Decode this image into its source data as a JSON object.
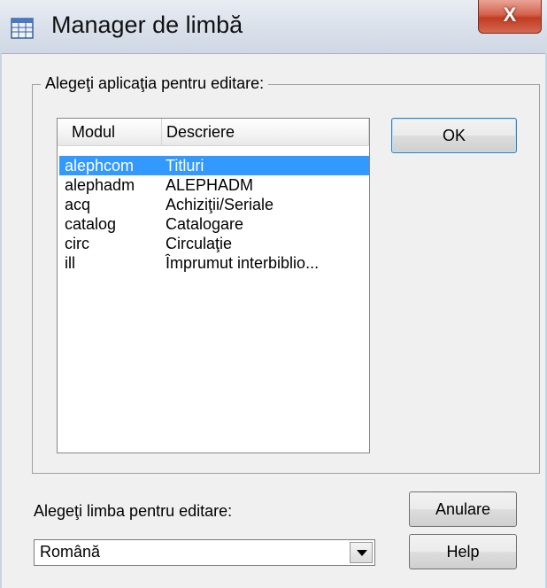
{
  "window": {
    "title": "Manager de limbă",
    "close_glyph": "X",
    "icon": "table-icon"
  },
  "module_group": {
    "legend": "Alegeţi aplicaţia pentru editare:",
    "columns": [
      "Modul",
      "Descriere"
    ],
    "rows": [
      {
        "modul": "alephcom",
        "descriere": "Titluri",
        "selected": true
      },
      {
        "modul": "alephadm",
        "descriere": "ALEPHADM",
        "selected": false
      },
      {
        "modul": "acq",
        "descriere": "Achiziţii/Seriale",
        "selected": false
      },
      {
        "modul": "catalog",
        "descriere": "Catalogare",
        "selected": false
      },
      {
        "modul": "circ",
        "descriere": "Circulaţie",
        "selected": false
      },
      {
        "modul": "ill",
        "descriere": "Împrumut interbiblio...",
        "selected": false
      }
    ]
  },
  "buttons": {
    "ok": "OK",
    "cancel": "Anulare",
    "help": "Help"
  },
  "language": {
    "label": "Alegeţi limba pentru editare:",
    "selected": "Română",
    "dropdown_icon": "chevron-down-icon"
  },
  "colors": {
    "selection": "#3399ff",
    "close_button": "#c23b22"
  }
}
